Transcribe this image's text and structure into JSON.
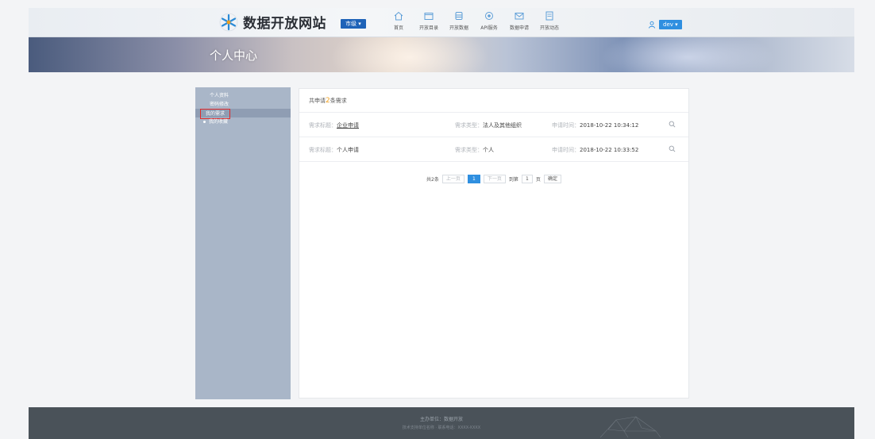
{
  "header": {
    "site_title": "数据开放网站",
    "city_select": "市级 ▾",
    "nav": [
      {
        "label": "首页",
        "icon": "home-icon"
      },
      {
        "label": "开放目录",
        "icon": "folder-icon"
      },
      {
        "label": "开放数据",
        "icon": "database-icon"
      },
      {
        "label": "API服务",
        "icon": "api-icon"
      },
      {
        "label": "数据申请",
        "icon": "mail-icon"
      },
      {
        "label": "开放动态",
        "icon": "document-icon"
      }
    ],
    "user_name": "dev ▾"
  },
  "banner": {
    "title": "个人中心"
  },
  "sidebar": {
    "items": [
      {
        "label": "个人资料"
      },
      {
        "label": "密码修改"
      },
      {
        "label": "我的需求"
      },
      {
        "label": "我的收藏"
      }
    ]
  },
  "main": {
    "header_prefix": "共申请",
    "header_count": "2",
    "header_suffix": "条需求",
    "rows": [
      {
        "title_label": "需求标题：",
        "title": "企业申请",
        "type_label": "需求类型：",
        "type": "法人及其他组织",
        "time_label": "申请时间：",
        "time": "2018-10-22 10:34:12"
      },
      {
        "title_label": "需求标题：",
        "title": "个人申请",
        "type_label": "需求类型：",
        "type": "个人",
        "time_label": "申请时间：",
        "time": "2018-10-22 10:33:52"
      }
    ],
    "pager": {
      "total": "共2条",
      "prev": "上一页",
      "current": "1",
      "next": "下一页",
      "goto": "到第",
      "page_input": "1",
      "page_unit": "页",
      "confirm": "确定"
    }
  },
  "footer": {
    "line1": "主办单位：数据开放",
    "line2": "技术支持单位名称 · 联系电话：XXXX-XXXX"
  },
  "colors": {
    "accent": "#2f8fe0",
    "city_button": "#1e63b8",
    "sidebar_bg": "#a9b6c8",
    "footer_bg": "#4a5259",
    "highlight_border": "#e02a2a",
    "count_color": "#f0a020"
  }
}
